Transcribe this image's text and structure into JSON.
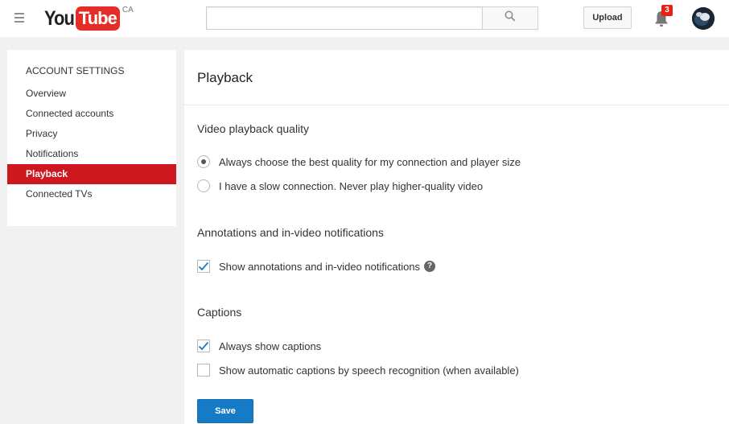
{
  "header": {
    "logo_you": "You",
    "logo_tube": "Tube",
    "logo_region": "CA",
    "search_value": "",
    "search_placeholder": "",
    "upload_label": "Upload",
    "notification_count": "3",
    "icons": {
      "menu": "hamburger-menu-icon",
      "search": "search-icon",
      "bell": "bell-icon",
      "avatar": "avatar"
    }
  },
  "sidebar": {
    "heading": "ACCOUNT SETTINGS",
    "items": [
      {
        "label": "Overview",
        "active": false
      },
      {
        "label": "Connected accounts",
        "active": false
      },
      {
        "label": "Privacy",
        "active": false
      },
      {
        "label": "Notifications",
        "active": false
      },
      {
        "label": "Playback",
        "active": true
      },
      {
        "label": "Connected TVs",
        "active": false
      }
    ]
  },
  "main": {
    "title": "Playback",
    "quality": {
      "title": "Video playback quality",
      "options": [
        {
          "label": "Always choose the best quality for my connection and player size",
          "selected": true
        },
        {
          "label": "I have a slow connection. Never play higher-quality video",
          "selected": false
        }
      ]
    },
    "annotations": {
      "title": "Annotations and in-video notifications",
      "option": {
        "label": "Show annotations and in-video notifications",
        "checked": true
      },
      "help_icon": "question-mark-icon"
    },
    "captions": {
      "title": "Captions",
      "options": [
        {
          "label": "Always show captions",
          "checked": true
        },
        {
          "label": "Show automatic captions by speech recognition (when available)",
          "checked": false
        }
      ]
    },
    "save_label": "Save"
  },
  "colors": {
    "brand_red": "#e52d27",
    "active_nav": "#cc181e",
    "primary_blue": "#167ac6",
    "badge_red": "#e62117"
  }
}
